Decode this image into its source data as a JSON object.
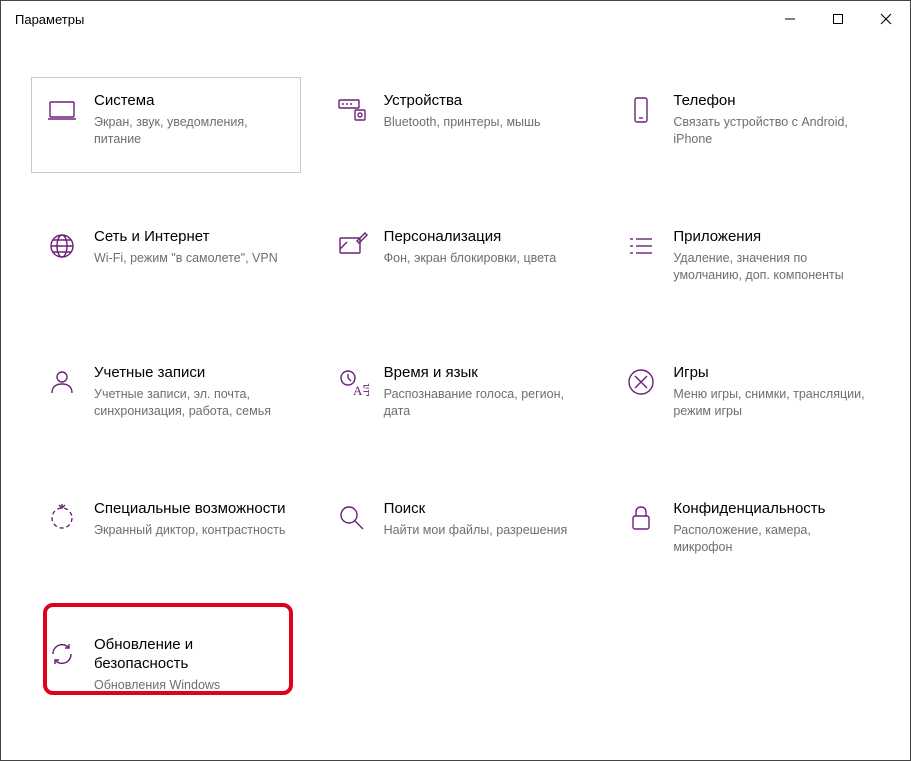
{
  "window": {
    "title": "Параметры"
  },
  "tiles": [
    {
      "label": "Система",
      "desc": "Экран, звук, уведомления, питание"
    },
    {
      "label": "Устройства",
      "desc": "Bluetooth, принтеры, мышь"
    },
    {
      "label": "Телефон",
      "desc": "Связать устройство с Android, iPhone"
    },
    {
      "label": "Сеть и Интернет",
      "desc": "Wi-Fi, режим \"в самолете\", VPN"
    },
    {
      "label": "Персонализация",
      "desc": "Фон, экран блокировки, цвета"
    },
    {
      "label": "Приложения",
      "desc": "Удаление, значения по умолчанию, доп. компоненты"
    },
    {
      "label": "Учетные записи",
      "desc": "Учетные записи, эл. почта, синхронизация, работа, семья"
    },
    {
      "label": "Время и язык",
      "desc": "Распознавание голоса, регион, дата"
    },
    {
      "label": "Игры",
      "desc": "Меню игры, снимки, трансляции, режим игры"
    },
    {
      "label": "Специальные возможности",
      "desc": "Экранный диктор, контрастность"
    },
    {
      "label": "Поиск",
      "desc": "Найти мои файлы, разрешения"
    },
    {
      "label": "Конфиденциальность",
      "desc": "Расположение, камера, микрофон"
    },
    {
      "label": "Обновление и безопасность",
      "desc": "Обновления Windows"
    }
  ]
}
